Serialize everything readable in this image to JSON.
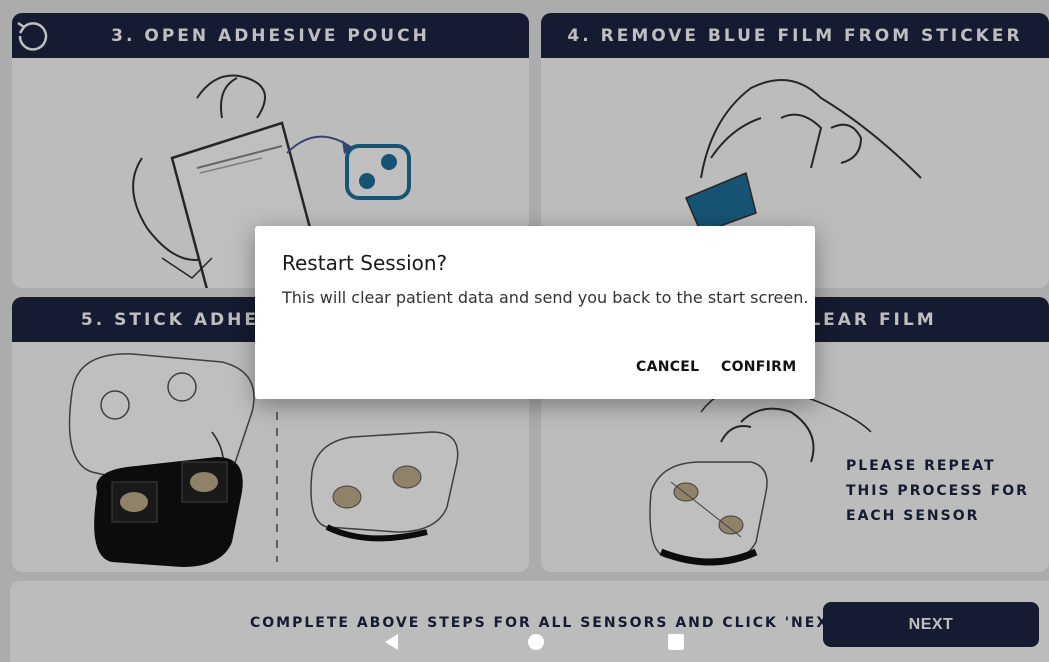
{
  "steps": [
    {
      "title": "3. OPEN ADHESIVE POUCH"
    },
    {
      "title": "4. REMOVE BLUE FILM FROM STICKER"
    },
    {
      "title": "5. STICK ADHESIVE TO SENSOR"
    },
    {
      "title": "6. REMOVE CLEAR FILM"
    }
  ],
  "repeat_note": "PLEASE REPEAT THIS PROCESS FOR EACH SENSOR",
  "footer": {
    "instruction": "COMPLETE ABOVE STEPS FOR ALL SENSORS AND CLICK 'NEXT'",
    "next_label": "NEXT"
  },
  "dialog": {
    "title": "Restart Session?",
    "message": "This will clear patient data and send you back to the start screen.",
    "cancel_label": "CANCEL",
    "confirm_label": "CONFIRM"
  },
  "colors": {
    "header_navy": "#1c2440",
    "accent_blue": "#1f6f9a",
    "sensor_black": "#111111",
    "sensor_pad": "#bfae8c"
  },
  "icons": {
    "restart": "restart-icon",
    "nav_back": "nav-back-icon",
    "nav_home": "nav-home-icon",
    "nav_recent": "nav-recent-icon"
  }
}
